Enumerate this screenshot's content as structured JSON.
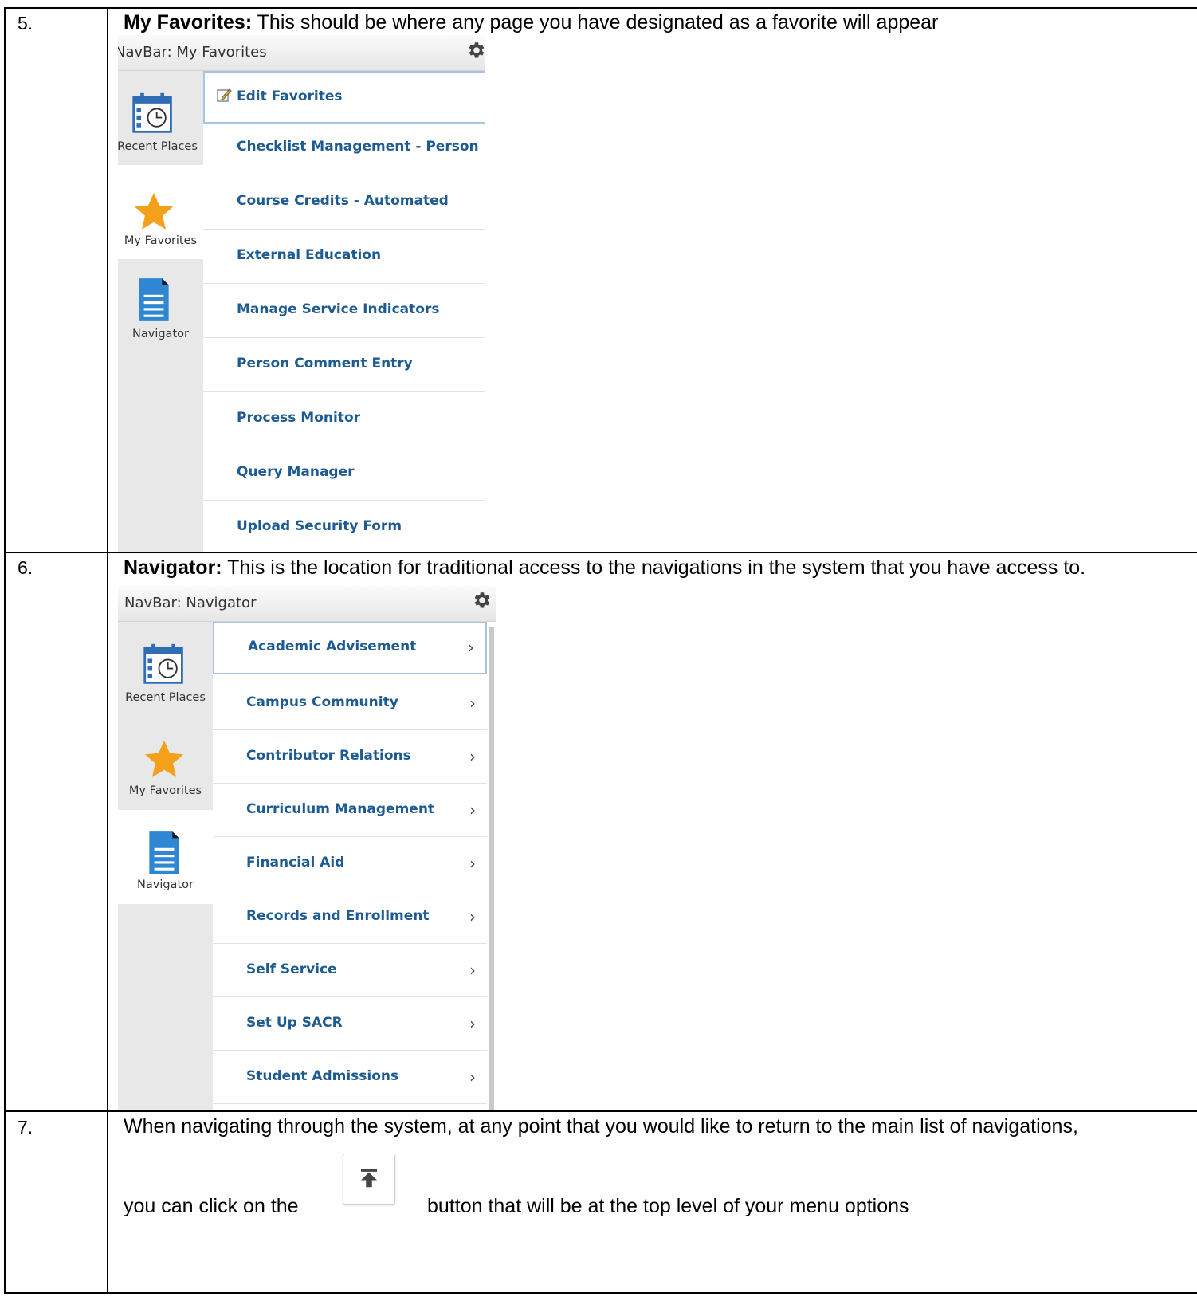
{
  "rows": [
    {
      "number": "5.",
      "title": "My Favorites:",
      "text": " This should be where any page you have designated as a favorite will appear",
      "navbar": {
        "title": "NavBar: My Favorites",
        "tiles": [
          "Recent Places",
          "My Favorites",
          "Navigator"
        ],
        "edit_label": "Edit Favorites",
        "items": [
          "Checklist Management - Person",
          "Course Credits - Automated",
          "External Education",
          "Manage Service Indicators",
          "Person Comment Entry",
          "Process Monitor",
          "Query Manager",
          "Upload Security Form"
        ]
      }
    },
    {
      "number": "6.",
      "title": "Navigator:",
      "text": "  This is the location for traditional access to the navigations in the system that you have access to.",
      "navbar": {
        "title": "NavBar: Navigator",
        "tiles": [
          "Recent Places",
          "My Favorites",
          "Navigator"
        ],
        "items": [
          "Academic Advisement",
          "Campus Community",
          "Contributor Relations",
          "Curriculum Management",
          "Financial Aid",
          "Records and Enrollment",
          "Self Service",
          "Set Up SACR",
          "Student Admissions"
        ],
        "chevron": "›"
      }
    },
    {
      "number": "7.",
      "line1": "When navigating through the system, at any point that you would like to return to the main list of navigations,",
      "line2a": "you can click on the",
      "line2b": "button  that will be at the top level of your menu options"
    }
  ],
  "colors": {
    "link": "#1e5b92",
    "star": "#f5a01a",
    "doc": "#2f86d3",
    "calendar": "#2f6db4"
  },
  "icons": [
    "gear-icon",
    "calendar-clock-icon",
    "star-icon",
    "document-icon",
    "edit-icon",
    "chevron-right-icon",
    "return-to-top-icon"
  ]
}
